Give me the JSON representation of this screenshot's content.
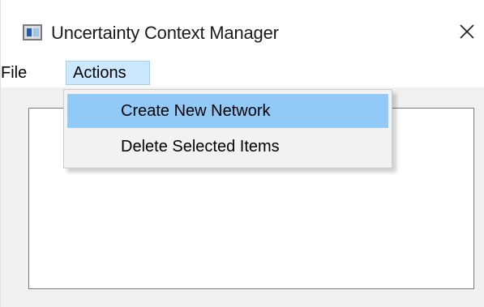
{
  "window": {
    "title": "Uncertainty Context Manager",
    "icon": "app-window-icon",
    "close_icon": "close-icon"
  },
  "menubar": {
    "items": [
      {
        "label": "File"
      },
      {
        "label": "Actions",
        "state": "open"
      }
    ]
  },
  "actions_menu": {
    "items": [
      {
        "label": "Create New Network",
        "highlighted": true
      },
      {
        "label": "Delete Selected Items",
        "highlighted": false
      }
    ]
  },
  "colors": {
    "menu_open_bg": "#cce8ff",
    "menu_highlight": "#91c9f7",
    "window_bg": "#f0f0f0"
  }
}
